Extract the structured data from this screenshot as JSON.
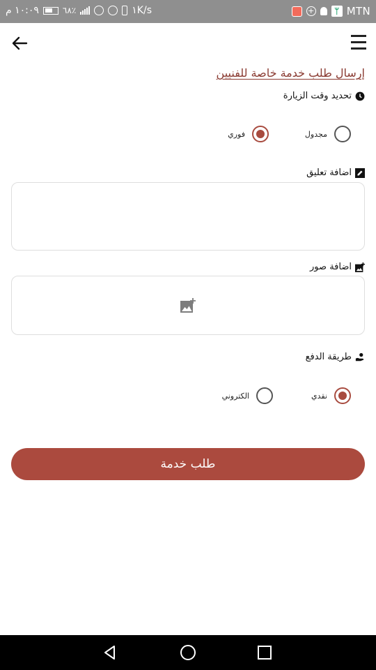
{
  "status_bar": {
    "carrier": "MTN",
    "speed": "١K/s",
    "battery": "٦٨٪",
    "time": "١٠:٠٩ م"
  },
  "app_bar": {
    "back_icon": "arrow-left-icon",
    "menu_icon": "menu-icon"
  },
  "page": {
    "title": "إرسال طلب خدمة خاصة للفنيين"
  },
  "visit_time": {
    "label": "تحديد وقت الزيارة",
    "icon": "clock-icon",
    "options": [
      {
        "label": "فوري",
        "checked": true
      },
      {
        "label": "مجدول",
        "checked": false
      }
    ]
  },
  "comment": {
    "label": "اضافة تعليق",
    "icon": "edit-icon",
    "value": ""
  },
  "images": {
    "label": "اضافة صور",
    "icon": "add-photo-icon",
    "placeholder_icon": "add-photo-icon"
  },
  "payment": {
    "label": "طريقة الدفع",
    "icon": "payment-hand-icon",
    "options": [
      {
        "label": "نقدي",
        "checked": true
      },
      {
        "label": "الكتروني",
        "checked": false
      }
    ]
  },
  "submit": {
    "label": "طلب خدمة"
  },
  "colors": {
    "accent": "#ab4a3e",
    "title": "#8a3a31",
    "status_bar": "#8f8f8f"
  }
}
